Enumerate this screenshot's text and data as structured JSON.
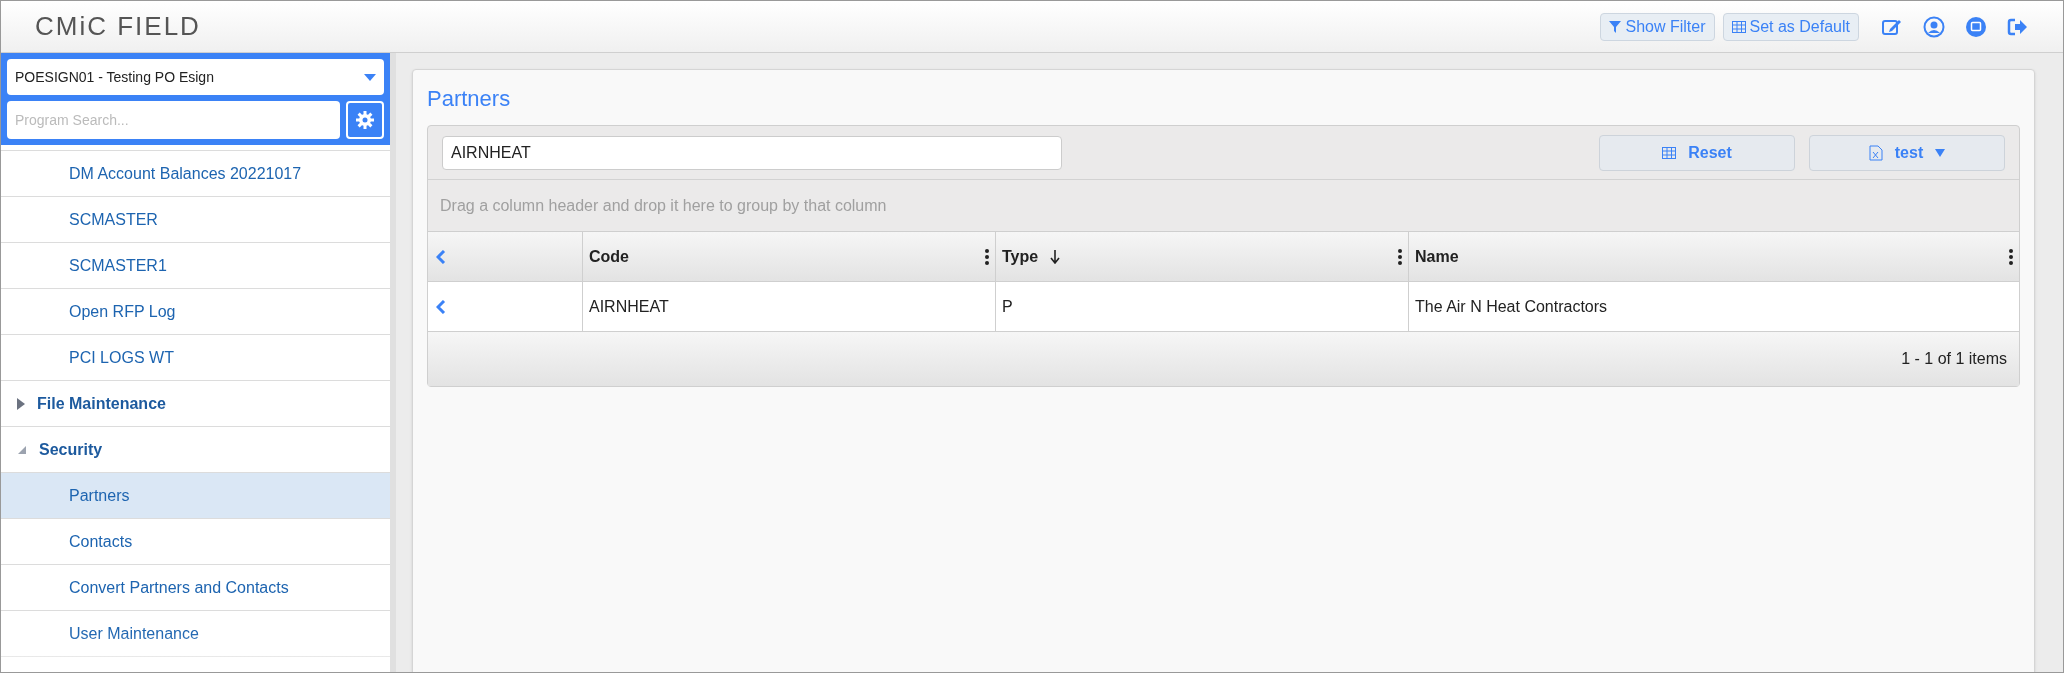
{
  "app": {
    "logo": "CMiC FIELD"
  },
  "header_buttons": [
    {
      "kind": "filter",
      "label": "Show Filter"
    },
    {
      "kind": "grid",
      "label": "Set as Default"
    }
  ],
  "header_icons": [
    {
      "kind": "edit"
    },
    {
      "kind": "user"
    },
    {
      "kind": "chat"
    },
    {
      "kind": "logout"
    }
  ],
  "sidebar": {
    "project": "POESIGN01 - Testing PO Esign",
    "search_placeholder": "Program Search...",
    "items": [
      {
        "label": "DM Account Balances 20221017",
        "selected": false
      },
      {
        "label": "SCMASTER",
        "selected": false
      },
      {
        "label": "SCMASTER1",
        "selected": false
      },
      {
        "label": "Open RFP Log",
        "selected": false
      },
      {
        "label": "PCI LOGS WT",
        "selected": false
      },
      {
        "label": "File Maintenance",
        "kind": "group",
        "expanded": false
      },
      {
        "label": "Security",
        "kind": "group",
        "expanded": true,
        "children": [
          {
            "label": "Partners",
            "selected": true
          },
          {
            "label": "Contacts",
            "selected": false
          },
          {
            "label": "Convert Partners and Contacts",
            "selected": false
          },
          {
            "label": "User Maintenance",
            "selected": false
          }
        ]
      }
    ]
  },
  "panel": {
    "title": "Partners",
    "search_value": "AIRNHEAT",
    "buttons": [
      {
        "kind": "reset",
        "label": "Reset"
      },
      {
        "kind": "export",
        "label": "test"
      }
    ],
    "group_hint": "Drag a column header and drop it here to group by that column",
    "table": {
      "columns": [
        {
          "label": "Code",
          "sorted": false
        },
        {
          "label": "Type",
          "sorted": true
        },
        {
          "label": "Name",
          "sorted": false
        }
      ],
      "rows": [
        [
          "AIRNHEAT",
          "P",
          "The Air N Heat Contractors"
        ]
      ]
    },
    "pager": "1 - 1 of 1 items"
  }
}
